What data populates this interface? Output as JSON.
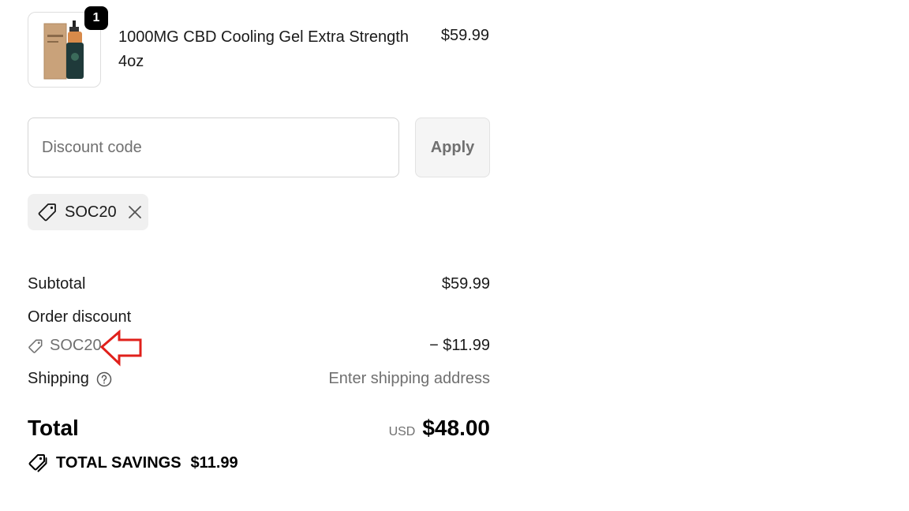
{
  "product": {
    "quantity": "1",
    "name": "1000MG CBD Cooling Gel Extra Strength 4oz",
    "price": "$59.99"
  },
  "discount": {
    "placeholder": "Discount code",
    "apply_label": "Apply",
    "applied_code": "SOC20"
  },
  "summary": {
    "subtotal_label": "Subtotal",
    "subtotal_value": "$59.99",
    "order_discount_label": "Order discount",
    "order_discount_code": "SOC20",
    "order_discount_value": "− $11.99",
    "shipping_label": "Shipping",
    "shipping_value": "Enter shipping address",
    "total_label": "Total",
    "total_currency": "USD",
    "total_value": "$48.00",
    "savings_label": "TOTAL SAVINGS",
    "savings_value": "$11.99"
  },
  "colors": {
    "annotation_arrow": "#e0201b",
    "badge": "#000000",
    "muted_text": "#707070"
  }
}
